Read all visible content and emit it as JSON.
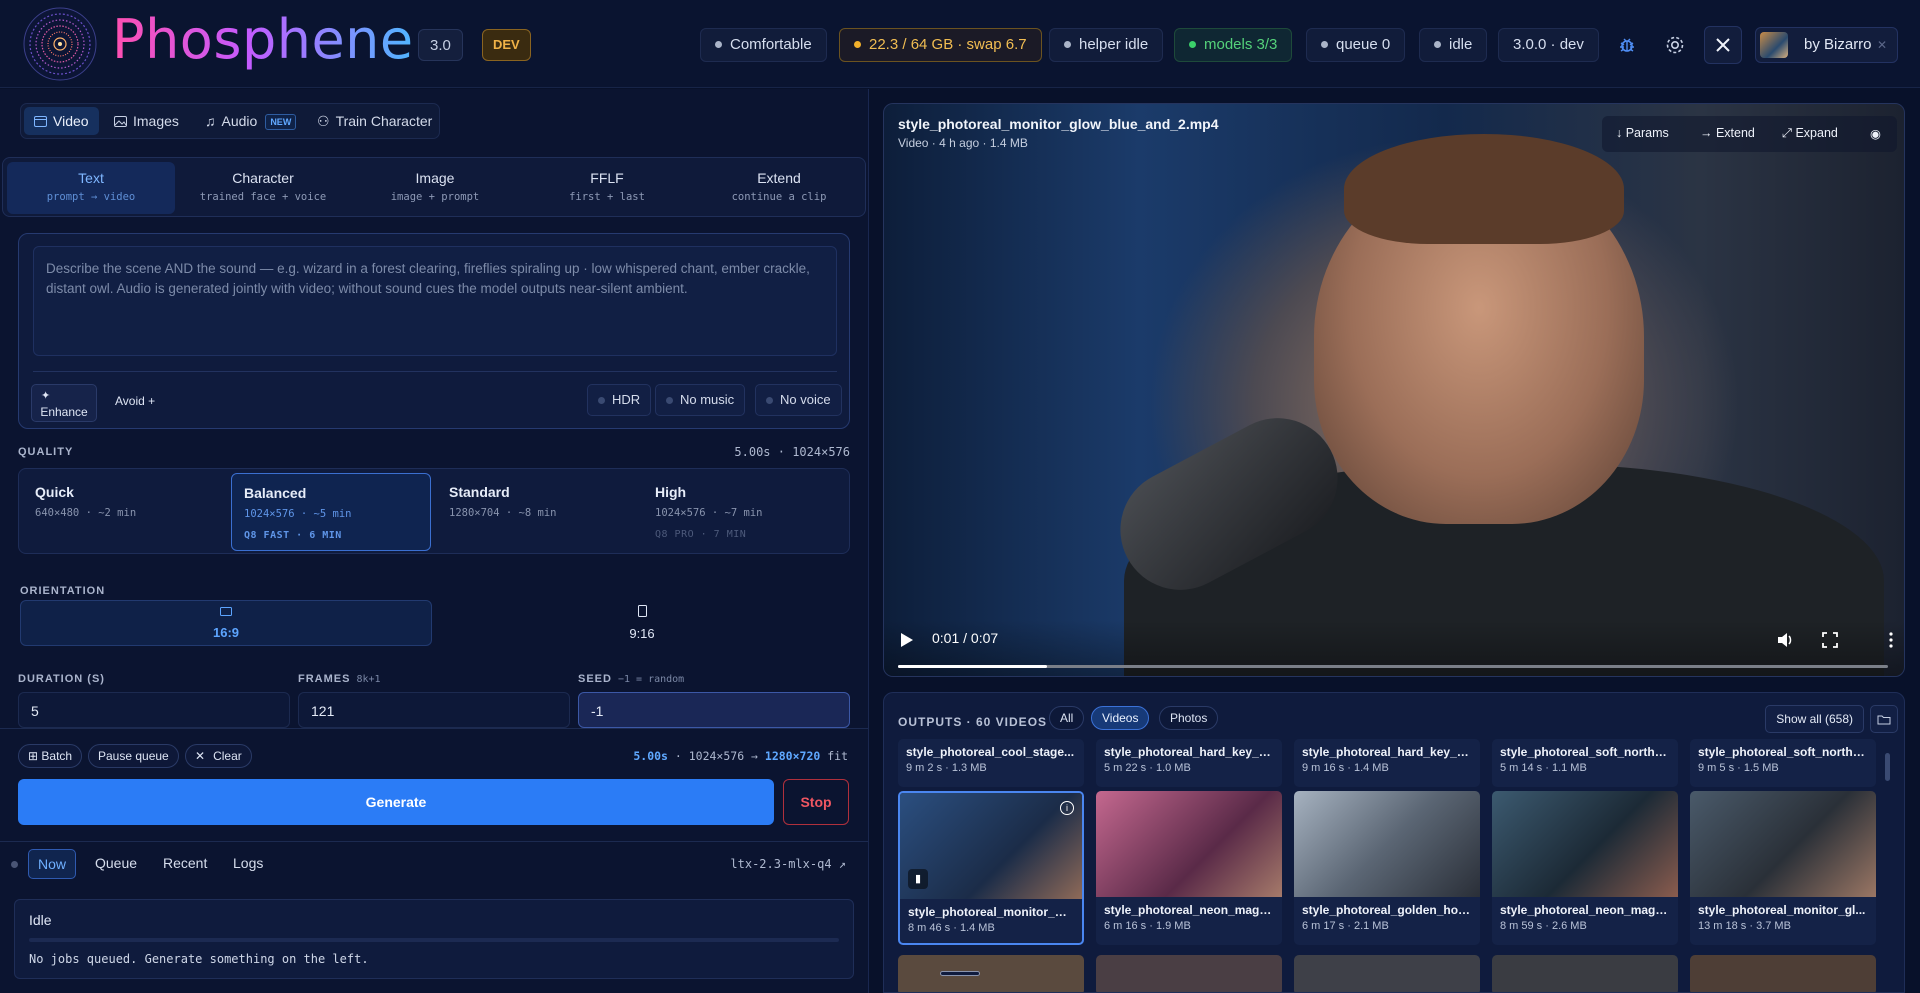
{
  "app": {
    "name": "Phosphene",
    "version": "3.0",
    "dev_badge": "DEV"
  },
  "status_bar": {
    "comfort": "Comfortable",
    "memory": "22.3 / 64 GB · swap 6.7",
    "helper": "helper idle",
    "models": "models 3/3",
    "queue": "queue 0",
    "state": "idle",
    "build": "3.0.0 · dev",
    "user": "by Bizarro",
    "user_close": "✕"
  },
  "modes": [
    {
      "label": "Video",
      "active": true
    },
    {
      "label": "Images"
    },
    {
      "label": "Audio",
      "badge": "NEW"
    },
    {
      "label": "Train Character"
    }
  ],
  "flow_tabs": [
    {
      "title": "Text",
      "sub": "prompt → video",
      "active": true
    },
    {
      "title": "Character",
      "sub": "trained face + voice"
    },
    {
      "title": "Image",
      "sub": "image + prompt"
    },
    {
      "title": "FFLF",
      "sub": "first + last"
    },
    {
      "title": "Extend",
      "sub": "continue a clip"
    }
  ],
  "prompt": {
    "placeholder": "Describe the scene AND the sound — e.g. wizard in a forest clearing, fireflies spiraling up · low whispered chant, ember crackle, distant owl. Audio is generated jointly with video; without sound cues the model outputs near-silent ambient.",
    "enhance": "Enhance",
    "avoid": "Avoid +",
    "chips": [
      "HDR",
      "No music",
      "No voice"
    ]
  },
  "quality": {
    "label": "QUALITY",
    "summary": "5.00s · 1024×576",
    "options": [
      {
        "title": "Quick",
        "sub": "640×480 · ~2 min",
        "extra": ""
      },
      {
        "title": "Balanced",
        "sub": "1024×576 · ~5 min",
        "extra": "Q8 FAST · 6 MIN",
        "active": true
      },
      {
        "title": "Standard",
        "sub": "1280×704 · ~8 min",
        "extra": ""
      },
      {
        "title": "High",
        "sub": "1024×576 · ~7 min",
        "extra": "Q8 PRO · 7 MIN"
      }
    ]
  },
  "orientation": {
    "label": "ORIENTATION",
    "options": [
      {
        "label": "16:9",
        "active": true
      },
      {
        "label": "9:16"
      }
    ]
  },
  "fields": {
    "duration_label": "DURATION (S)",
    "duration": "5",
    "frames_label": "FRAMES",
    "frames_hint": "8k+1",
    "frames": "121",
    "seed_label": "SEED",
    "seed_hint": "−1 = random",
    "seed": "-1"
  },
  "actions": {
    "batch": "⊞ Batch",
    "pause": "Pause queue",
    "clear": "Clear",
    "summary_pre": "5.00s",
    "summary_mid": " · 1024×576 → ",
    "summary_res": "1280×720",
    "summary_post": " fit",
    "generate": "Generate",
    "stop": "Stop"
  },
  "bottom_tabs": [
    {
      "label": "Now",
      "active": true
    },
    {
      "label": "Queue"
    },
    {
      "label": "Recent"
    },
    {
      "label": "Logs"
    }
  ],
  "model_tag": "ltx-2.3-mlx-q4 ↗",
  "status": {
    "title": "Idle",
    "message": "No jobs queued. Generate something on the left."
  },
  "player": {
    "title": "style_photoreal_monitor_glow_blue_and_2.mp4",
    "meta": "Video · 4 h ago · 1.4 MB",
    "tools": [
      "↓ Params",
      "→ Extend",
      "⤢ Expand"
    ],
    "time": "0:01 / 0:07",
    "progress": 0.15
  },
  "outputs": {
    "title": "OUTPUTS · 60 VIDEOS",
    "filters": [
      {
        "label": "All"
      },
      {
        "label": "Videos",
        "active": true
      },
      {
        "label": "Photos"
      }
    ],
    "show_all": "Show all (658)",
    "top_row": [
      {
        "name": "style_photoreal_cool_stage...",
        "meta": "9 m 2 s · 1.3 MB"
      },
      {
        "name": "style_photoreal_hard_key_li...",
        "meta": "5 m 22 s · 1.0 MB"
      },
      {
        "name": "style_photoreal_hard_key_li...",
        "meta": "9 m 16 s · 1.4 MB"
      },
      {
        "name": "style_photoreal_soft_north_...",
        "meta": "5 m 14 s · 1.1 MB"
      },
      {
        "name": "style_photoreal_soft_north_...",
        "meta": "9 m 5 s · 1.5 MB"
      }
    ],
    "main_row": [
      {
        "name": "style_photoreal_monitor_gl...",
        "meta": "8 m 46 s · 1.4 MB",
        "color": "#23446f",
        "selected": true
      },
      {
        "name": "style_photoreal_neon_mage...",
        "meta": "6 m 16 s · 1.9 MB",
        "color": "#a2557a"
      },
      {
        "name": "style_photoreal_golden_hou...",
        "meta": "6 m 17 s · 2.1 MB",
        "color": "#8a97a6"
      },
      {
        "name": "style_photoreal_neon_mage...",
        "meta": "8 m 59 s · 2.6 MB",
        "color": "#2f4a5c"
      },
      {
        "name": "style_photoreal_monitor_gl...",
        "meta": "13 m 18 s · 3.7 MB",
        "color": "#3b4a5a"
      }
    ]
  }
}
